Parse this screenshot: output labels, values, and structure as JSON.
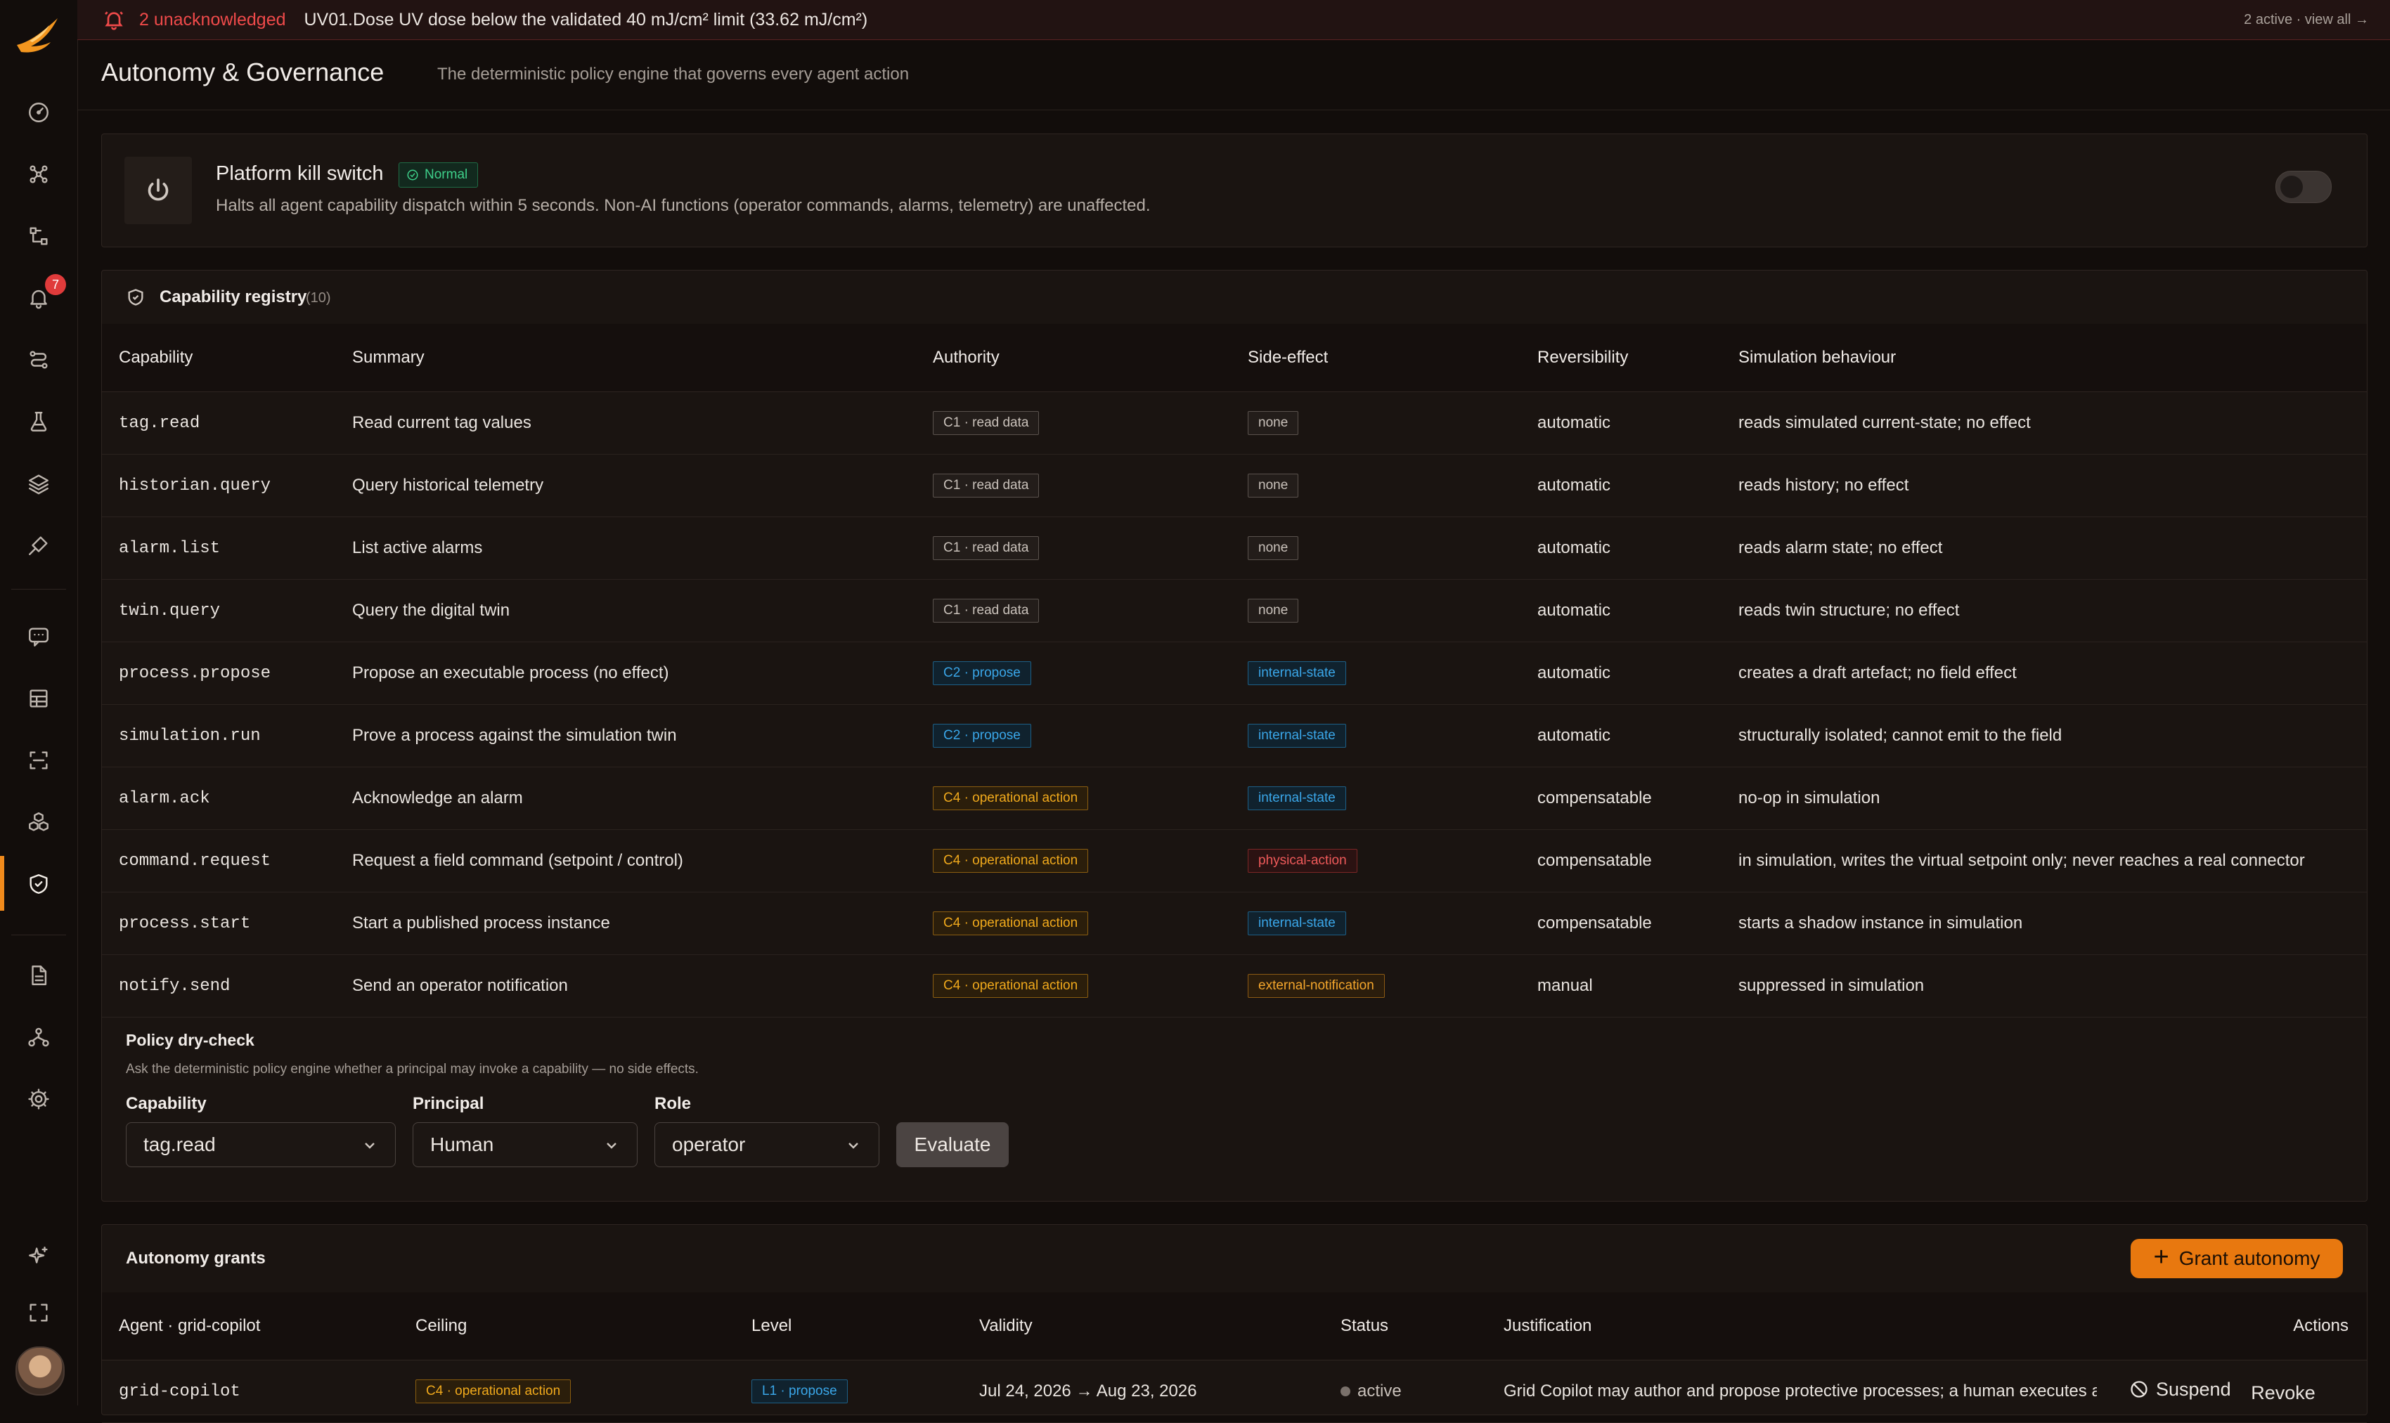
{
  "alert": {
    "count": "2 unacknowledged",
    "message": "UV01.Dose UV dose below the validated 40 mJ/cm² limit (33.62 mJ/cm²)",
    "right": "2 active · view all →"
  },
  "sidebar": {
    "notification_badge": "7",
    "icons": [
      "gauge-icon",
      "nodes-icon",
      "flow-icon",
      "bell-icon",
      "route-icon",
      "flask-icon",
      "layers-icon",
      "probe-icon",
      "chat-icon",
      "grid-icon",
      "scan-icon",
      "cubes-icon",
      "shield-icon",
      "document-icon",
      "hierarchy-icon",
      "gear-icon",
      "sparkle-icon",
      "expand-icon"
    ],
    "active": "shield-icon"
  },
  "header": {
    "title": "Autonomy & Governance",
    "subtitle": "The deterministic policy engine that governs every agent action"
  },
  "kill_switch": {
    "title": "Platform kill switch",
    "status": "Normal",
    "description": "Halts all agent capability dispatch within 5 seconds. Non-AI functions (operator commands, alarms, telemetry) are unaffected.",
    "enabled": false
  },
  "registry": {
    "title": "Capability registry",
    "count": "(10)",
    "columns": [
      "Capability",
      "Summary",
      "Authority",
      "Side-effect",
      "Reversibility",
      "Simulation behaviour"
    ],
    "rows": [
      {
        "capability": "tag.read",
        "summary": "Read current tag values",
        "authority": "C1 · read data",
        "side_effect": "none",
        "reversibility": "automatic",
        "simulation": "reads simulated current-state; no effect"
      },
      {
        "capability": "historian.query",
        "summary": "Query historical telemetry",
        "authority": "C1 · read data",
        "side_effect": "none",
        "reversibility": "automatic",
        "simulation": "reads history; no effect"
      },
      {
        "capability": "alarm.list",
        "summary": "List active alarms",
        "authority": "C1 · read data",
        "side_effect": "none",
        "reversibility": "automatic",
        "simulation": "reads alarm state; no effect"
      },
      {
        "capability": "twin.query",
        "summary": "Query the digital twin",
        "authority": "C1 · read data",
        "side_effect": "none",
        "reversibility": "automatic",
        "simulation": "reads twin structure; no effect"
      },
      {
        "capability": "process.propose",
        "summary": "Propose an executable process (no effect)",
        "authority": "C2 · propose",
        "side_effect": "internal-state",
        "reversibility": "automatic",
        "simulation": "creates a draft artefact; no field effect"
      },
      {
        "capability": "simulation.run",
        "summary": "Prove a process against the simulation twin",
        "authority": "C2 · propose",
        "side_effect": "internal-state",
        "reversibility": "automatic",
        "simulation": "structurally isolated; cannot emit to the field"
      },
      {
        "capability": "alarm.ack",
        "summary": "Acknowledge an alarm",
        "authority": "C4 · operational action",
        "side_effect": "internal-state",
        "reversibility": "compensatable",
        "simulation": "no-op in simulation"
      },
      {
        "capability": "command.request",
        "summary": "Request a field command (setpoint / control)",
        "authority": "C4 · operational action",
        "side_effect": "physical-action",
        "reversibility": "compensatable",
        "simulation": "in simulation, writes the virtual setpoint only; never reaches a real connector"
      },
      {
        "capability": "process.start",
        "summary": "Start a published process instance",
        "authority": "C4 · operational action",
        "side_effect": "internal-state",
        "reversibility": "compensatable",
        "simulation": "starts a shadow instance in simulation"
      },
      {
        "capability": "notify.send",
        "summary": "Send an operator notification",
        "authority": "C4 · operational action",
        "side_effect": "external-notification",
        "reversibility": "manual",
        "simulation": "suppressed in simulation"
      }
    ]
  },
  "dry_check": {
    "title": "Policy dry-check",
    "description": "Ask the deterministic policy engine whether a principal may invoke a capability — no side effects.",
    "capability_label": "Capability",
    "capability_value": "tag.read",
    "principal_label": "Principal",
    "principal_value": "Human",
    "role_label": "Role",
    "role_value": "operator",
    "evaluate_label": "Evaluate"
  },
  "grants": {
    "title": "Autonomy grants",
    "button": "Grant autonomy",
    "columns": [
      "Agent · grid-copilot",
      "Ceiling",
      "Level",
      "Validity",
      "Status",
      "Justification",
      "Actions"
    ],
    "rows": [
      {
        "agent": "grid-copilot",
        "ceiling": "C4 · operational action",
        "level": "L1 · propose",
        "validity": "Jul 24, 2026 → Aug 23, 2026",
        "status": "active",
        "justification": "Grid Copilot may author and propose protective processes; a human executes all field actions",
        "suspend": "Suspend",
        "revoke": "Revoke"
      }
    ]
  },
  "colors": {
    "accent": "#f08a1c",
    "alert": "#ef4a4a",
    "normal": "#3ed08a",
    "propose": "#3aa6e8"
  }
}
